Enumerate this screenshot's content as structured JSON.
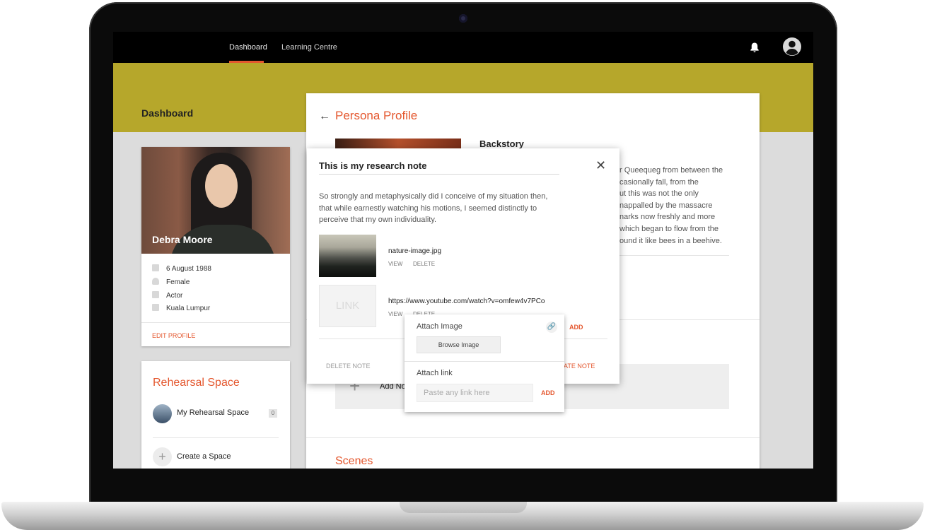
{
  "nav": {
    "tabs": [
      {
        "label": "Dashboard",
        "active": true
      },
      {
        "label": "Learning Centre",
        "active": false
      }
    ],
    "icons": [
      "bell-icon",
      "user-account-icon"
    ]
  },
  "dashboard": {
    "title": "Dashboard"
  },
  "profile": {
    "name": "Debra Moore",
    "details": [
      {
        "icon": "calendar-icon",
        "text": "6 August 1988"
      },
      {
        "icon": "person-icon",
        "text": "Female"
      },
      {
        "icon": "briefcase-icon",
        "text": "Actor"
      },
      {
        "icon": "location-icon",
        "text": "Kuala Lumpur"
      }
    ],
    "edit_label": "EDIT PROFILE"
  },
  "rehearsal": {
    "title": "Rehearsal Space",
    "space_name": "My Rehearsal Space",
    "count": "0",
    "create_label": "Create a Space"
  },
  "persona": {
    "title": "Persona Profile",
    "backstory_title": "Backstory",
    "backstory_lines": [
      "r Queequeg from between the",
      "casionally fall, from the",
      "ut this was not the only",
      "nappalled by the massacre",
      "narks now freshly and more",
      "which began to flow from the",
      "ound it like bees in a beehive."
    ],
    "add_note_label": "Add No",
    "scenes_title": "Scenes"
  },
  "note_modal": {
    "title": "This is my research note",
    "body": "So strongly and metaphysically did I conceive of my situation then, that while earnestly watching his motions, I seemed distinctly to perceive that my own individuality.",
    "attachments": [
      {
        "name": "nature-image.jpg",
        "view": "VIEW",
        "delete": "DELETE"
      },
      {
        "name": "https://www.youtube.com/watch?v=omfew4v7PCo",
        "thumb_label": "LINK",
        "view": "VIEW",
        "delete": "DELETE"
      }
    ],
    "delete_note": "DELETE NOTE",
    "create_note": "EATE NOTE"
  },
  "attach_popup": {
    "image_label": "Attach Image",
    "browse_label": "Browse Image",
    "add_outside": "ADD",
    "link_label": "Attach link",
    "link_placeholder": "Paste any link here",
    "add_label": "ADD"
  },
  "colors": {
    "accent": "#e4572e",
    "banner": "#b6a72b",
    "topbar": "#000000"
  }
}
